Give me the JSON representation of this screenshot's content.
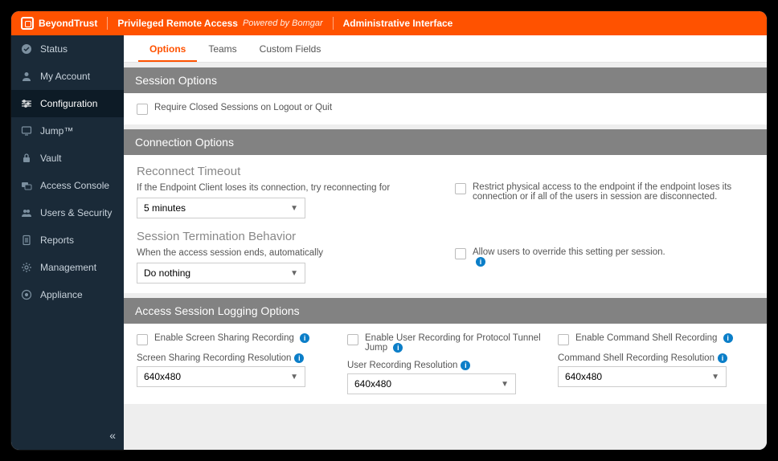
{
  "topbar": {
    "brand": "BeyondTrust",
    "product": "Privileged Remote Access",
    "powered": "Powered by Bomgar",
    "section": "Administrative Interface"
  },
  "sidebar": {
    "items": [
      {
        "label": "Status"
      },
      {
        "label": "My Account"
      },
      {
        "label": "Configuration"
      },
      {
        "label": "Jump™"
      },
      {
        "label": "Vault"
      },
      {
        "label": "Access Console"
      },
      {
        "label": "Users & Security"
      },
      {
        "label": "Reports"
      },
      {
        "label": "Management"
      },
      {
        "label": "Appliance"
      }
    ]
  },
  "subtabs": {
    "options": "Options",
    "teams": "Teams",
    "custom": "Custom Fields"
  },
  "session_options": {
    "title": "Session Options",
    "require_closed": "Require Closed Sessions on Logout or Quit"
  },
  "connection": {
    "title": "Connection Options",
    "reconnect_heading": "Reconnect Timeout",
    "reconnect_help": "If the Endpoint Client loses its connection, try reconnecting for",
    "reconnect_value": "5 minutes",
    "restrict": "Restrict physical access to the endpoint if the endpoint loses its connection or if all of the users in session are disconnected.",
    "term_heading": "Session Termination Behavior",
    "term_help": "When the access session ends, automatically",
    "term_value": "Do nothing",
    "override": "Allow users to override this setting per session."
  },
  "logging": {
    "title": "Access Session Logging Options",
    "enable_screen": "Enable Screen Sharing Recording",
    "enable_user": "Enable User Recording for Protocol Tunnel Jump",
    "enable_cmd": "Enable Command Shell Recording",
    "screen_res_label": "Screen Sharing Recording Resolution",
    "user_res_label": "User Recording Resolution",
    "cmd_res_label": "Command Shell Recording Resolution",
    "res_value": "640x480"
  }
}
